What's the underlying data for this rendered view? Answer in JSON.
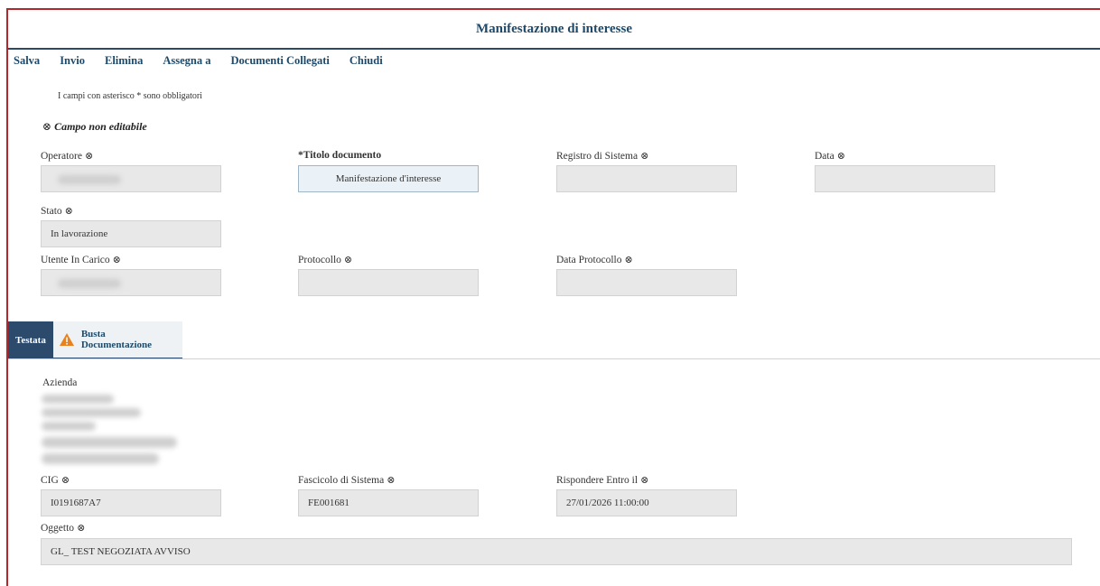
{
  "header": {
    "title": "Manifestazione di interesse"
  },
  "toolbar": {
    "items": [
      "Salva",
      "Invio",
      "Elimina",
      "Assegna a",
      "Documenti Collegati",
      "Chiudi"
    ]
  },
  "note": "I campi con asterisco * sono obbligatori",
  "legend": {
    "symbol": "⊗",
    "text": "Campo non editabile"
  },
  "fields": {
    "operatore": {
      "label": "Operatore",
      "value": ""
    },
    "titolo": {
      "label": "*Titolo documento",
      "value": "Manifestazione d'interesse"
    },
    "registro": {
      "label": "Registro di Sistema",
      "value": ""
    },
    "data": {
      "label": "Data",
      "value": ""
    },
    "stato": {
      "label": "Stato",
      "value": "In lavorazione"
    },
    "utente": {
      "label": "Utente In Carico",
      "value": ""
    },
    "protocollo": {
      "label": "Protocollo",
      "value": ""
    },
    "data_protocollo": {
      "label": "Data Protocollo",
      "value": ""
    }
  },
  "tabs": [
    {
      "label": "Testata",
      "active": true
    },
    {
      "label": "Busta Documentazione",
      "active": false,
      "icon": "warning-icon"
    }
  ],
  "testata": {
    "azienda_label": "Azienda",
    "cig": {
      "label": "CIG",
      "value": "I0191687A7"
    },
    "fascicolo": {
      "label": "Fascicolo di Sistema",
      "value": "FE001681"
    },
    "rispondere": {
      "label": "Rispondere Entro il",
      "value": "27/01/2026 11:00:00"
    },
    "oggetto": {
      "label": "Oggetto",
      "value": "GL_ TEST NEGOZIATA AVVISO"
    }
  },
  "colors": {
    "accent": "#1d4a6b",
    "tab_active": "#2c4a6b",
    "frame": "#b0282c",
    "warning": "#e8821e"
  }
}
